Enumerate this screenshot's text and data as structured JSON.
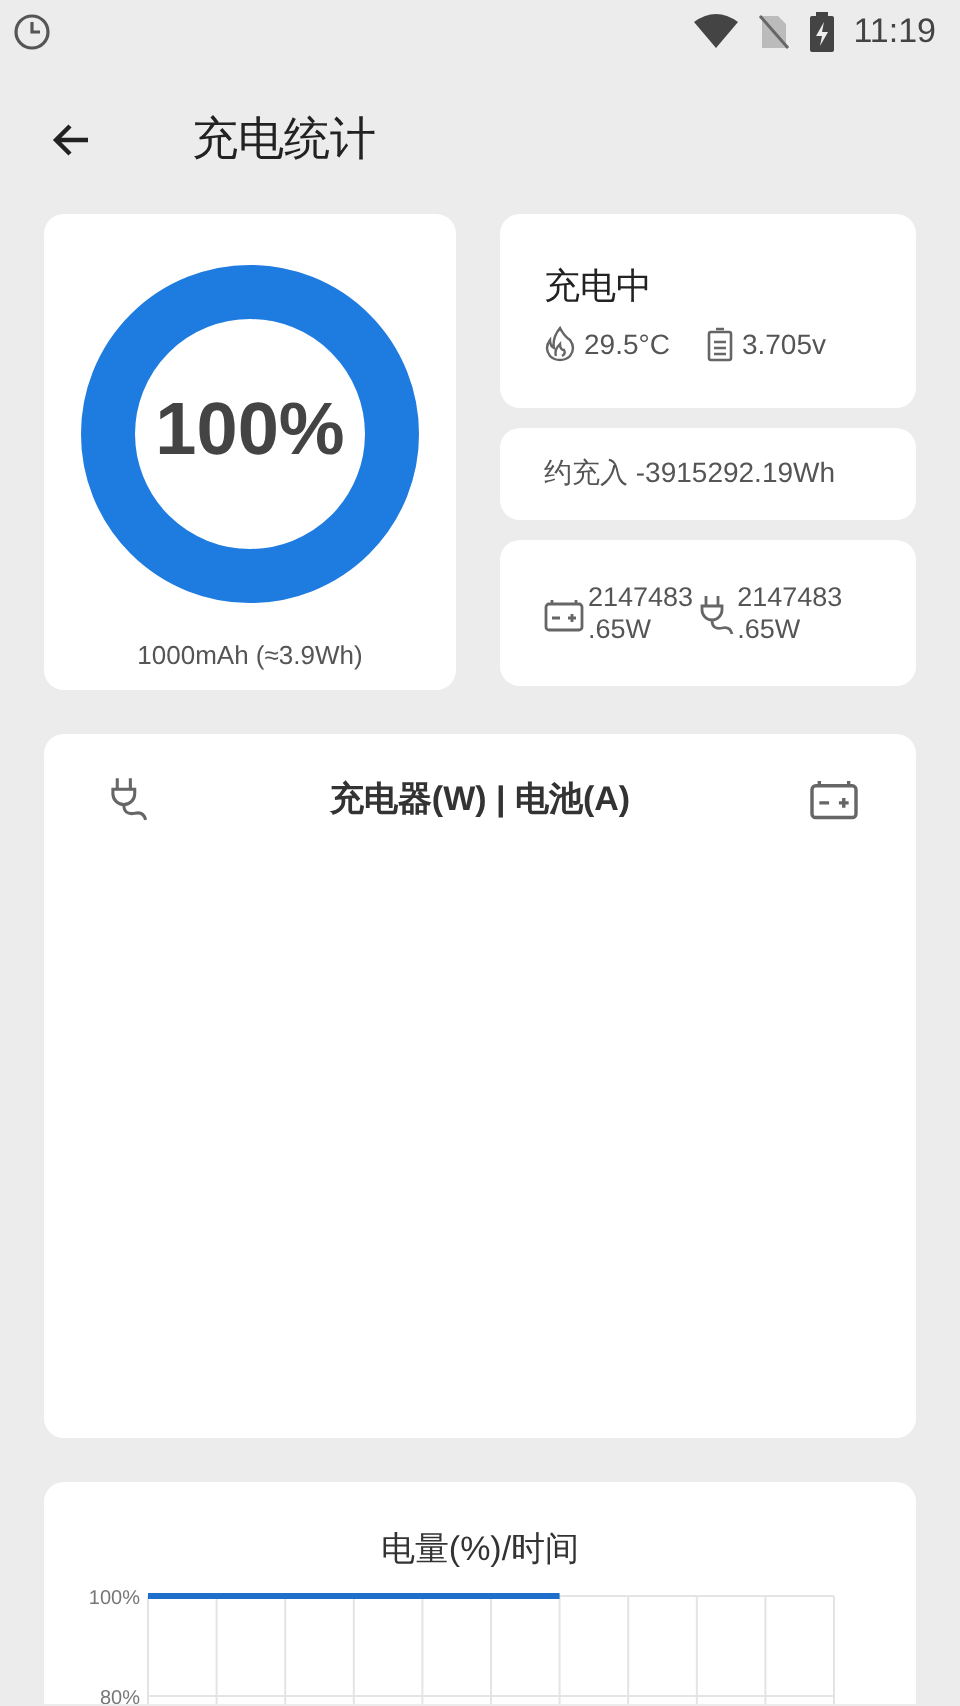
{
  "status_bar": {
    "time": "11:19"
  },
  "header": {
    "title": "充电统计"
  },
  "battery_card": {
    "percent": "100%",
    "capacity": "1000mAh (≈3.9Wh)"
  },
  "status_card": {
    "state": "充电中",
    "temperature": "29.5°C",
    "voltage": "3.705v"
  },
  "energy_card": {
    "text": "约充入 -3915292.19Wh"
  },
  "power_card": {
    "battery_power": "2147483\n.65W",
    "charger_power": "2147483\n.65W"
  },
  "power_chart": {
    "title": "充电器(W) | 电池(A)"
  },
  "level_chart": {
    "chart_data": {
      "type": "line",
      "title": "电量(%)/时间",
      "categories": [
        null,
        null,
        null,
        null,
        null,
        null,
        null
      ],
      "ylim": [
        80,
        100
      ],
      "grid": true,
      "yticks": [
        {
          "value": 100,
          "label": "100%"
        },
        {
          "value": 80,
          "label": "80%"
        }
      ],
      "series": [
        {
          "color": "#1e6fcc",
          "values": [
            100,
            100,
            100,
            100,
            100,
            100,
            100
          ]
        }
      ]
    }
  }
}
